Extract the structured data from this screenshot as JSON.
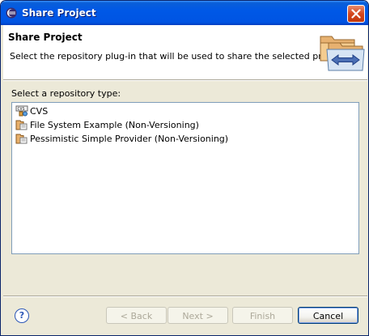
{
  "window": {
    "title": "Share Project"
  },
  "banner": {
    "title": "Share Project",
    "description": "Select the repository plug-in that will be used to share the selected project."
  },
  "list": {
    "label": "Select a repository type:",
    "items": [
      {
        "label": "CVS",
        "icon": "cvs-repository-icon"
      },
      {
        "label": "File System Example (Non-Versioning)",
        "icon": "provider-icon"
      },
      {
        "label": "Pessimistic Simple Provider (Non-Versioning)",
        "icon": "provider-icon"
      }
    ]
  },
  "buttons": {
    "help": "?",
    "back": "< Back",
    "next": "Next >",
    "finish": "Finish",
    "cancel": "Cancel"
  },
  "colors": {
    "titlebar": "#0054e3",
    "dialog_bg": "#ece9d8",
    "list_border": "#7f9db9"
  }
}
